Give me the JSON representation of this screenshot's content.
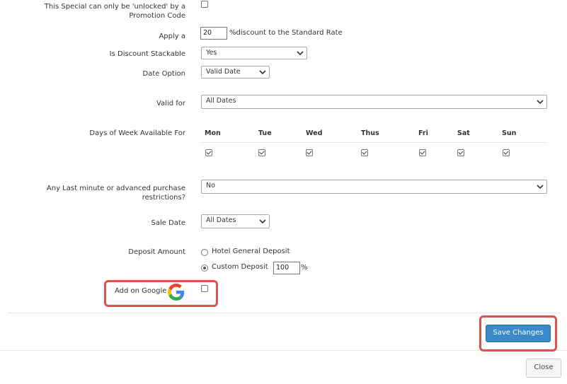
{
  "form": {
    "promo_unlock_label": "This Special can only be 'unlocked' by a Promotion Code",
    "apply_label": "Apply a",
    "apply_value": "20",
    "apply_suffix": "%discount to the Standard Rate",
    "stackable_label": "Is Discount Stackable",
    "stackable_value": "Yes",
    "date_option_label": "Date Option",
    "date_option_value": "Valid Date",
    "valid_for_label": "Valid for",
    "valid_for_value": "All Dates",
    "days_label": "Days of Week Available For",
    "days": [
      {
        "name": "Mon",
        "checked": true
      },
      {
        "name": "Tue",
        "checked": true
      },
      {
        "name": "Wed",
        "checked": true
      },
      {
        "name": "Thus",
        "checked": true
      },
      {
        "name": "Fri",
        "checked": true
      },
      {
        "name": "Sat",
        "checked": true
      },
      {
        "name": "Sun",
        "checked": true
      }
    ],
    "restrictions_label": "Any Last minute or advanced purchase restrictions?",
    "restrictions_value": "No",
    "sale_date_label": "Sale Date",
    "sale_date_value": "All Dates",
    "deposit_label": "Deposit Amount",
    "deposit_option_general": "Hotel General Deposit",
    "deposit_option_custom": "Custom Deposit",
    "custom_deposit_value": "100",
    "custom_deposit_suffix": "%",
    "google_label": "Add on Google"
  },
  "footer": {
    "save_label": "Save Changes",
    "close_label": "Close"
  },
  "colors": {
    "highlight": "#d9534f",
    "primary": "#3a89c9"
  },
  "icons": {
    "google": "google-g-logo",
    "chevron": "chevron-down-icon"
  }
}
